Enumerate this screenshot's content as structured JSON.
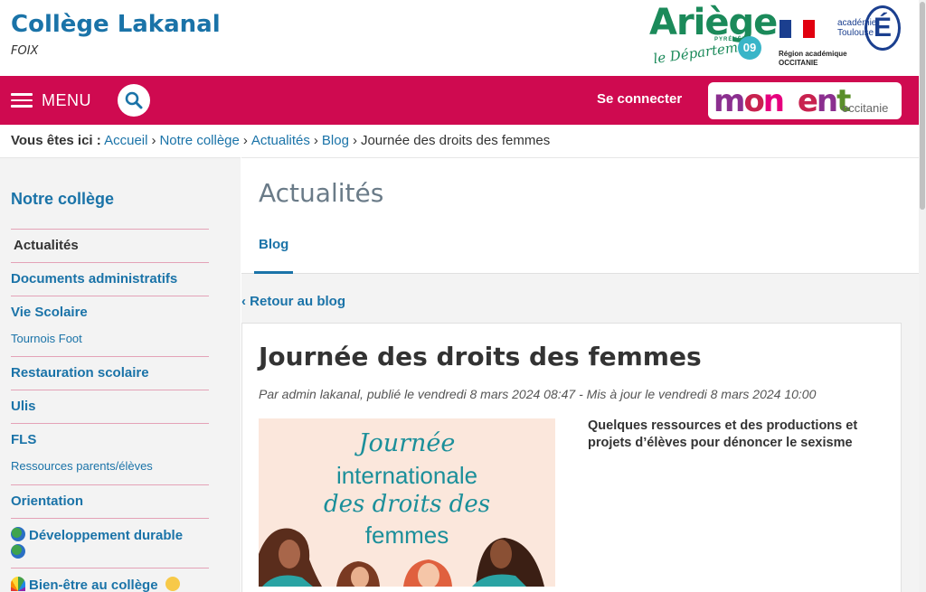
{
  "header": {
    "title": "Collège Lakanal",
    "subtitle": "FOIX"
  },
  "logos": {
    "ariege": {
      "word": "Ariège",
      "pyrenees": "PYRÉNÉES",
      "departement": "le Département",
      "number": "09"
    },
    "region": {
      "line1": "Région académique",
      "line2": "OCCITANIE"
    },
    "academie": {
      "line1": "académie",
      "line2": "Toulouse",
      "letter": "É"
    },
    "monent": {
      "word": "mon ent",
      "region": "occitanie"
    }
  },
  "nav": {
    "menu_label": "MENU",
    "login_label": "Se connecter",
    "color": "#cf0a50"
  },
  "breadcrumb": {
    "label": "Vous êtes ici :",
    "items": [
      "Accueil",
      "Notre collège",
      "Actualités",
      "Blog"
    ],
    "current": "Journée des droits des femmes"
  },
  "sidebar": {
    "title": "Notre collège",
    "items": [
      {
        "label": "Actualités",
        "active": true
      },
      {
        "label": "Documents administratifs"
      },
      {
        "label": "Vie Scolaire",
        "sub": "Tournois Foot"
      },
      {
        "label": "Restauration scolaire"
      },
      {
        "label": "Ulis"
      },
      {
        "label": "FLS",
        "sub": "Ressources parents/élèves"
      },
      {
        "label": "Orientation"
      },
      {
        "label": "Développement durable",
        "emoji": "globe"
      },
      {
        "label": "Bien-être au collège",
        "emoji": "rainbow"
      }
    ]
  },
  "main": {
    "section_title": "Actualités",
    "tab": "Blog",
    "back_link": "‹ Retour au blog"
  },
  "article": {
    "title": "Journée des droits des femmes",
    "meta": "Par admin lakanal, publié le vendredi 8 mars 2024 08:47 - Mis à jour le vendredi 8 mars 2024 10:00",
    "intro": "Quelques ressources et des productions et projets d’élèves pour dénoncer le sexisme",
    "image_text": [
      "Journée",
      "internationale",
      "des droits des",
      "femmes"
    ]
  },
  "colors": {
    "accent": "#1a73a8",
    "brand": "#cf0a50",
    "sidebar_bg": "#f3f3f3"
  }
}
